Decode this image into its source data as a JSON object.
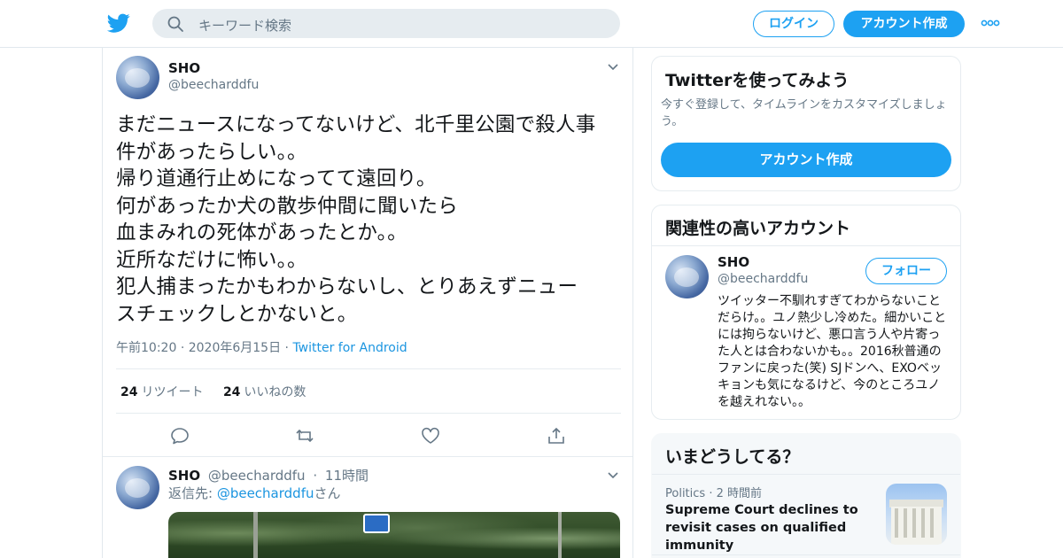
{
  "topbar": {
    "search_placeholder": "キーワード検索",
    "login_label": "ログイン",
    "signup_label": "アカウント作成"
  },
  "tweet": {
    "name": "SHO",
    "handle": "@beecharddfu",
    "text": "まだニュースになってないけど、北千里公園で殺人事\n件があったらしい。。\n帰り道通行止めになってて遠回り。\n何があったか犬の散歩仲間に聞いたら\n血まみれの死体があったとか。。\n近所なだけに怖い。。\n犯人捕まったかもわからないし、とりあえずニュー\nスチェックしとかないと。",
    "time": "午前10:20",
    "date": "2020年6月15日",
    "source": "Twitter for Android",
    "retweets_count": "24",
    "retweets_label": "リツイート",
    "likes_count": "24",
    "likes_label": "いいねの数"
  },
  "reply_tweet": {
    "name": "SHO",
    "handle": "@beecharddfu",
    "age": "11時間",
    "reply_prefix": "返信先: ",
    "reply_to": "@beecharddfu",
    "reply_suffix": "さん"
  },
  "sidebar": {
    "signup_card": {
      "title": "Twitterを使ってみよう",
      "description": "今すぐ登録して、タイムラインをカスタマイズしましょう。",
      "button": "アカウント作成"
    },
    "related_card": {
      "title": "関連性の高いアカウント",
      "name": "SHO",
      "handle": "@beecharddfu",
      "follow_label": "フォロー",
      "bio": "ツイッター不馴れすぎてわからないことだらけ。。ユノ熱少し冷めた。細かいことには拘らないけど、悪口言う人や片寄った人とは合わないかも。。2016秋普通のファンに戻った(笑) SJドンへ、EXOベッキョンも気になるけど、今のところユノを越えれない。。"
    },
    "trends_card": {
      "title": "いまどうしてる？",
      "category": "Politics",
      "age": "2 時間前",
      "headline": "Supreme Court declines to revisit cases on qualified immunity"
    }
  },
  "colors": {
    "accent": "#1da1f2",
    "link": "#1b95e0",
    "secondary_text": "#657786"
  }
}
